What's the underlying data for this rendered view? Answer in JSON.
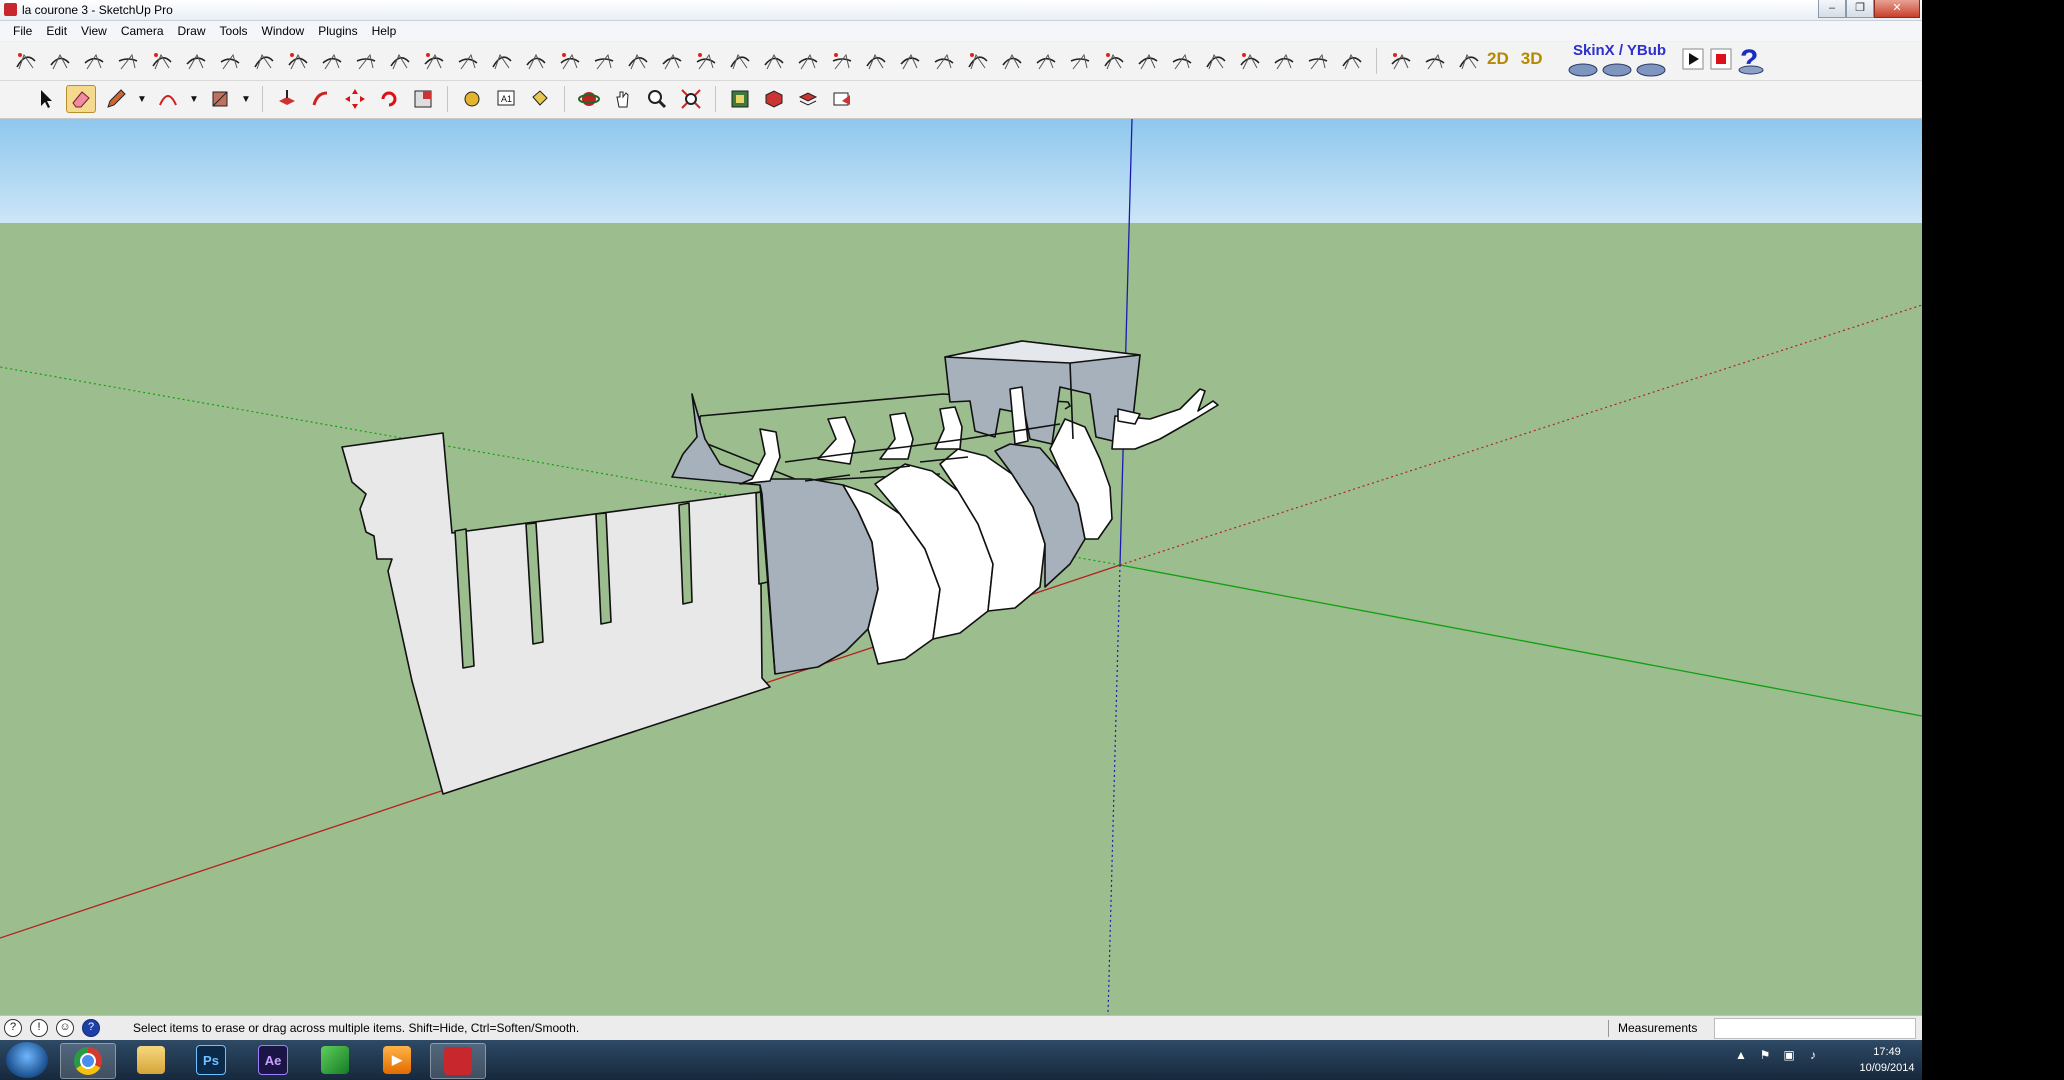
{
  "window": {
    "title": "la courone 3 - SketchUp Pro",
    "controls": {
      "minimize": "–",
      "maximize": "❐",
      "close": "✕"
    }
  },
  "menu": [
    "File",
    "Edit",
    "View",
    "Camera",
    "Draw",
    "Tools",
    "Window",
    "Plugins",
    "Help"
  ],
  "toolbar": {
    "label_2d": "2D",
    "label_3d": "3D",
    "skin_label": "SkinX / YBub"
  },
  "viewport": {
    "sky_color": "#a8d4f2",
    "ground_color": "#9cbd8e",
    "axis_red": "#b32222",
    "axis_green": "#10a010",
    "axis_blue": "#1b1bb0"
  },
  "status": {
    "hint": "Select items to erase or drag across multiple items. Shift=Hide, Ctrl=Soften/Smooth.",
    "measurements_label": "Measurements",
    "measurements_value": ""
  },
  "taskbar": {
    "apps": [
      {
        "name": "chrome",
        "label": ""
      },
      {
        "name": "explorer",
        "label": ""
      },
      {
        "name": "photoshop",
        "label": "Ps"
      },
      {
        "name": "after-effects",
        "label": "Ae"
      },
      {
        "name": "app-green",
        "label": ""
      },
      {
        "name": "media-player",
        "label": ""
      },
      {
        "name": "sketchup",
        "label": ""
      }
    ],
    "time": "17:49",
    "date": "10/09/2014"
  }
}
